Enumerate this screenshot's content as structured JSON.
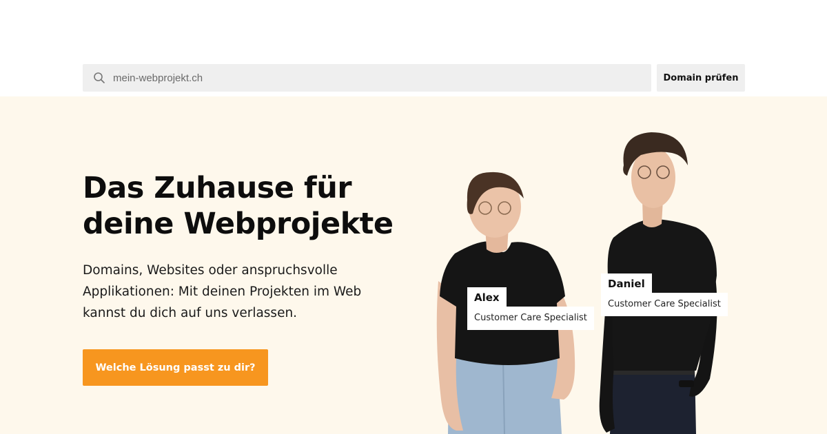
{
  "search": {
    "placeholder": "mein-webprojekt.ch",
    "button_label": "Domain prüfen",
    "icon": "search-icon"
  },
  "hero": {
    "headline": "Das Zuhause für deine Webprojekte",
    "lead": "Domains, Websites oder anspruchsvolle Applikationen: Mit deinen Projekten im Web kannst du dich auf uns verlassen.",
    "cta_label": "Welche Lösung passt zu dir?"
  },
  "people": [
    {
      "name": "Alex",
      "role": "Customer Care Specialist"
    },
    {
      "name": "Daniel",
      "role": "Customer Care Specialist"
    }
  ],
  "colors": {
    "hero_background": "#fef8ec",
    "accent": "#f7961f",
    "search_background": "#efefef"
  }
}
